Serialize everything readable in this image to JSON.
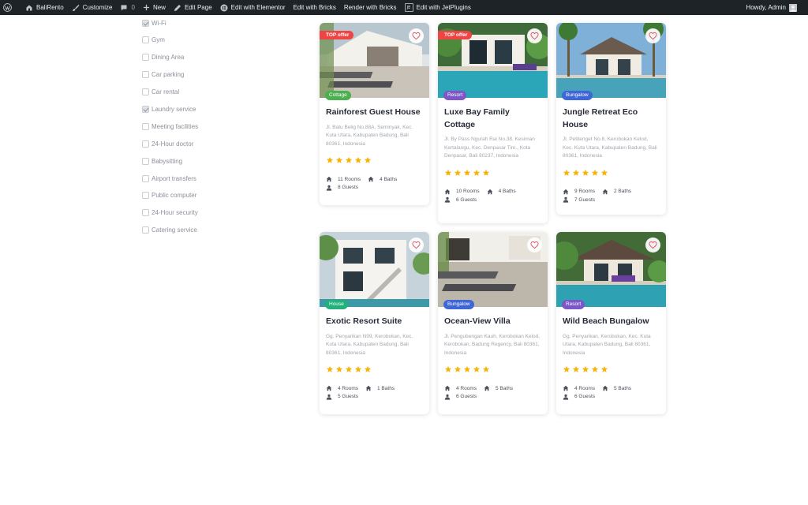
{
  "adminbar": {
    "site": "BaliRento",
    "customize": "Customize",
    "comments": "0",
    "new": "New",
    "edit_page": "Edit Page",
    "elementor": "Edit with Elementor",
    "bricks_edit": "Edit with Bricks",
    "bricks_render": "Render with Bricks",
    "jet": "Edit with JetPlugins",
    "jet_icon_text": "JE",
    "howdy": "Howdy, Admin"
  },
  "filters": [
    {
      "label": "Wi-Fi",
      "checked": true
    },
    {
      "label": "Gym",
      "checked": false
    },
    {
      "label": "Dining Area",
      "checked": false
    },
    {
      "label": "Car parking",
      "checked": false
    },
    {
      "label": "Car rental",
      "checked": false
    },
    {
      "label": "Laundry service",
      "checked": true
    },
    {
      "label": "Meeting facilities",
      "checked": false
    },
    {
      "label": "24-Hour doctor",
      "checked": false
    },
    {
      "label": "Babysitting",
      "checked": false
    },
    {
      "label": "Airport transfers",
      "checked": false
    },
    {
      "label": "Public computer",
      "checked": false
    },
    {
      "label": "24-Hour security",
      "checked": false
    },
    {
      "label": "Catering service",
      "checked": false
    }
  ],
  "colors": {
    "cottage": "#4caf50",
    "resort": "#7b57c7",
    "bungalow": "#3f66d6",
    "house": "#22b07d",
    "top_offer": "#ef4444",
    "star": "#f5b50a",
    "heart": "#e0566b"
  },
  "listings": [
    {
      "title": "Rainforest Guest House",
      "type": "Cottage",
      "top_offer": "TOP offer",
      "address": "Jl. Batu Belig No.88A, Seminyak, Kec. Kuta Utara, Kabupaten Badung, Bali 80361, Indonesia",
      "rooms": "11 Rooms",
      "baths": "4 Baths",
      "guests": "8 Guests",
      "rating": 5
    },
    {
      "title": "Luxe Bay Family Cottage",
      "type": "Resort",
      "top_offer": "TOP offer",
      "address": "Jl. By Pass Ngurah Rai No.38, Kesiman Kertalangu, Kec. Denpasar Tim., Kota Denpasar, Bali 80237, Indonesia",
      "rooms": "10 Rooms",
      "baths": "4 Baths",
      "guests": "6 Guests",
      "rating": 5
    },
    {
      "title": "Jungle Retreat Eco House",
      "type": "Bungalow",
      "top_offer": "",
      "address": "Jl. Petitenget No.8, Kerobokan Kelod, Kec. Kuta Utara, Kabupaten Badung, Bali 80361, Indonesia",
      "rooms": "9 Rooms",
      "baths": "2 Baths",
      "guests": "7 Guests",
      "rating": 5
    },
    {
      "title": "Exotic Resort Suite",
      "type": "House",
      "top_offer": "",
      "address": "Gg. Penyarikan N99, Kerobokan, Kec. Kuta Utara, Kabupaten Badung, Bali 80361, Indonesia",
      "rooms": "4 Rooms",
      "baths": "1 Baths",
      "guests": "5 Guests",
      "rating": 5
    },
    {
      "title": "Ocean-View Villa",
      "type": "Bungalow",
      "top_offer": "",
      "address": "Jl. Pengubengan Kauh, Kerobokan Kelod, Kerobokan, Badung Regency, Bali 80361, Indonesia",
      "rooms": "4 Rooms",
      "baths": "5 Baths",
      "guests": "6 Guests",
      "rating": 5
    },
    {
      "title": "Wild Beach Bungalow",
      "type": "Resort",
      "top_offer": "",
      "address": "Gg. Penyarikan, Kerobokan, Kec. Kuta Utara, Kabupaten Badung, Bali 80361, Indonesia",
      "rooms": "4 Rooms",
      "baths": "5 Baths",
      "guests": "6 Guests",
      "rating": 5
    }
  ]
}
